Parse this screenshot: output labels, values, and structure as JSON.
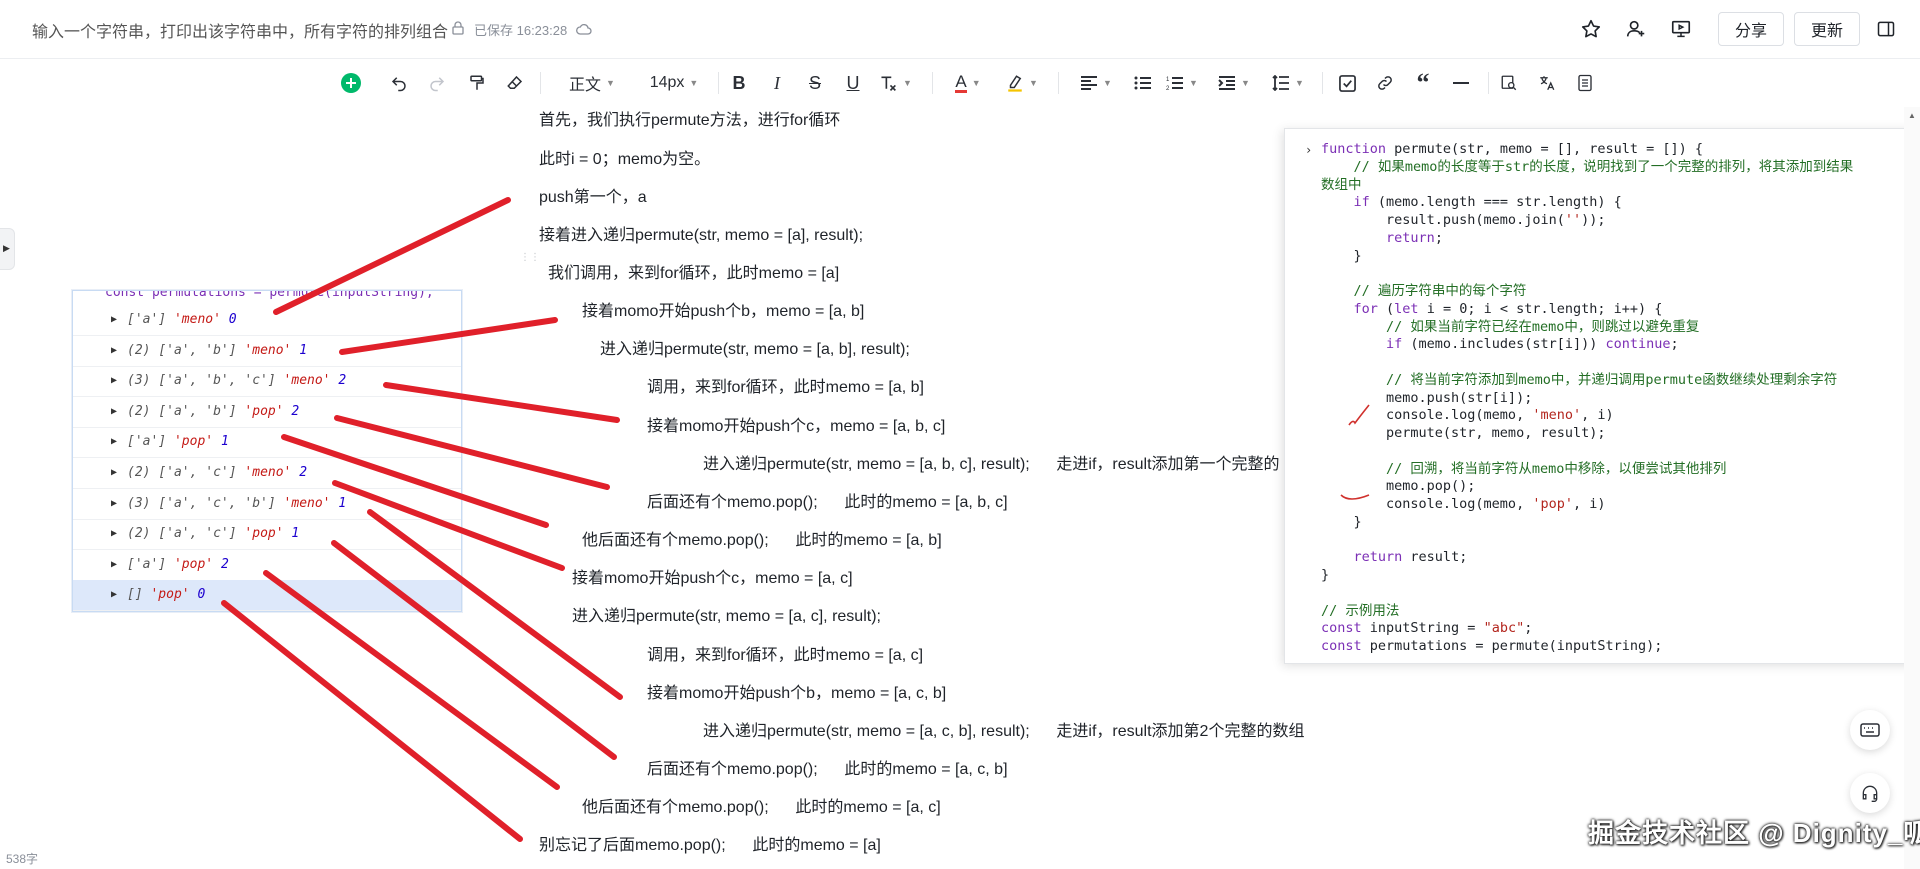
{
  "header": {
    "title": "输入一个字符串，打印出该字符串中，所有字符的排列组合",
    "saved_status": "已保存 16:23:28",
    "share_label": "分享",
    "update_label": "更新",
    "icons": [
      "lock-icon",
      "cloud-icon",
      "star-icon",
      "add-user-icon",
      "present-icon",
      "sidebar-toggle-icon"
    ]
  },
  "toolbar": {
    "paragraph_style": "正文",
    "font_size": "14px",
    "text_color": "A",
    "accent_color": "#00b96b",
    "red_color": "#e53935",
    "items": [
      "add",
      "undo",
      "redo",
      "format-painter",
      "eraser",
      "paragraph-style",
      "font-size",
      "bold",
      "italic",
      "strikethrough",
      "underline",
      "clear-format",
      "text-color",
      "highlight",
      "align",
      "bullet-list",
      "ordered-list",
      "indent",
      "line-height",
      "task",
      "link",
      "quote",
      "divider",
      "find",
      "translate",
      "more"
    ]
  },
  "doc": {
    "lines": [
      "首先，我们执行permute方法，进行for循环",
      "此时i = 0；memo为空。",
      "push第一个，a",
      "接着进入递归permute(str, memo = [a], result);",
      "我们调用，来到for循环，此时memo = [a]",
      "接着momo开始push个b，memo = [a, b]",
      "进入递归permute(str, memo = [a, b], result);",
      "调用，来到for循环，此时memo = [a, b]",
      "接着momo开始push个c，memo = [a, b, c]",
      "进入递归permute(str, memo = [a, b, c], result);      走进if，result添加第一个完整的",
      "后面还有个memo.pop();      此时的memo = [a, b, c]",
      "他后面还有个memo.pop();      此时的memo = [a, b]",
      "接着momo开始push个c，memo = [a, c]",
      "进入递归permute(str, memo = [a, c], result);",
      "调用，来到for循环，此时memo = [a, c]",
      "接着momo开始push个b，memo = [a, c, b]",
      "进入递归permute(str, memo = [a, c, b], result);      走进if，result添加第2个完整的数组",
      "后面还有个memo.pop();      此时的memo = [a, c, b]",
      "他后面还有个memo.pop();      此时的memo = [a, c]",
      "别忘记了后面memo.pop();      此时的memo = [a]"
    ],
    "word_count": "538字"
  },
  "console": {
    "header_line": "const permutations = permute(inputString);",
    "rows": [
      {
        "count": "",
        "arr": "['a']",
        "tag": "'meno'",
        "n": "0"
      },
      {
        "count": "(2) ",
        "arr": "['a', 'b']",
        "tag": "'meno'",
        "n": "1"
      },
      {
        "count": "(3) ",
        "arr": "['a', 'b', 'c']",
        "tag": "'meno'",
        "n": "2"
      },
      {
        "count": "(2) ",
        "arr": "['a', 'b']",
        "tag": "'pop'",
        "n": "2"
      },
      {
        "count": "",
        "arr": "['a']",
        "tag": "'pop'",
        "n": "1"
      },
      {
        "count": "(2) ",
        "arr": "['a', 'c']",
        "tag": "'meno'",
        "n": "2"
      },
      {
        "count": "(3) ",
        "arr": "['a', 'c', 'b']",
        "tag": "'meno'",
        "n": "1"
      },
      {
        "count": "(2) ",
        "arr": "['a', 'c']",
        "tag": "'pop'",
        "n": "1"
      },
      {
        "count": "",
        "arr": "['a']",
        "tag": "'pop'",
        "n": "2"
      },
      {
        "count": "",
        "arr": "[]",
        "tag": "'pop'",
        "n": "0"
      }
    ]
  },
  "code": {
    "lines": [
      "function permute(str, memo = [], result = []) {",
      "    // 如果memo的长度等于str的长度，说明找到了一个完整的排列，将其添加到结果",
      "数组中",
      "    if (memo.length === str.length) {",
      "        result.push(memo.join(''));",
      "        return;",
      "    }",
      "",
      "    // 遍历字符串中的每个字符",
      "    for (let i = 0; i < str.length; i++) {",
      "        // 如果当前字符已经在memo中，则跳过以避免重复",
      "        if (memo.includes(str[i])) continue;",
      "",
      "        // 将当前字符添加到memo中，并递归调用permute函数继续处理剩余字符",
      "        memo.push(str[i]);",
      "        console.log(memo, 'meno', i)",
      "        permute(str, memo, result);",
      "",
      "        // 回溯，将当前字符从memo中移除，以便尝试其他排列",
      "        memo.pop();",
      "        console.log(memo, 'pop', i)",
      "    }",
      "",
      "    return result;",
      "}",
      "",
      "// 示例用法",
      "const inputString = \"abc\";",
      "const permutations = permute(inputString);"
    ]
  },
  "watermark": "掘金技术社区 @ Dignity_呱"
}
